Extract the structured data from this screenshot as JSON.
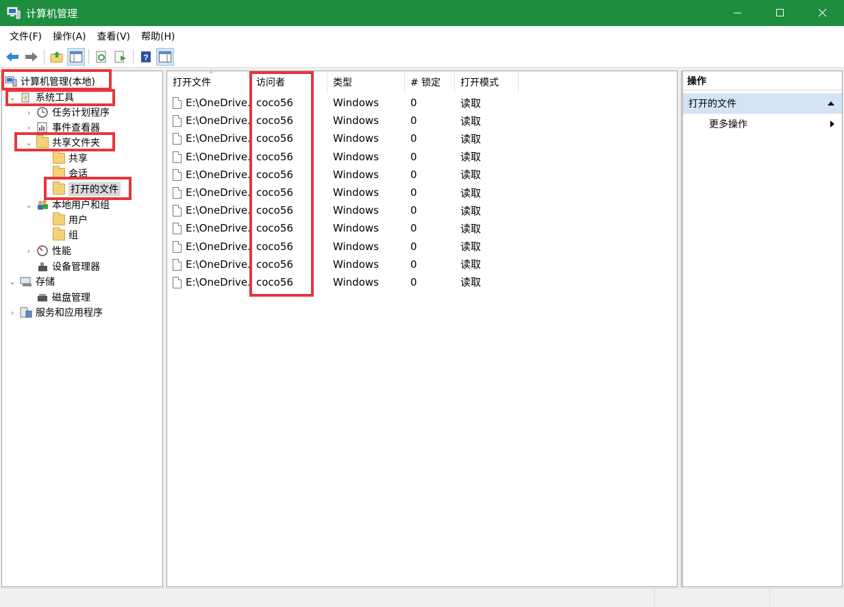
{
  "window": {
    "title": "计算机管理"
  },
  "menu": [
    "文件(F)",
    "操作(A)",
    "查看(V)",
    "帮助(H)"
  ],
  "toolbar": {
    "buttons": [
      "back-arrow-icon",
      "forward-arrow-icon",
      "up-folder-icon",
      "show-hide-tree-icon",
      "refresh-icon",
      "export-list-icon",
      "help-icon",
      "show-hide-action-pane-icon"
    ]
  },
  "tree": {
    "root": "计算机管理(本地)",
    "system_tools": "系统工具",
    "task_scheduler": "任务计划程序",
    "event_viewer": "事件查看器",
    "shared_folders": "共享文件夹",
    "shares": "共享",
    "sessions": "会话",
    "open_files": "打开的文件",
    "local_users": "本地用户和组",
    "users": "用户",
    "groups": "组",
    "performance": "性能",
    "device_manager": "设备管理器",
    "storage": "存储",
    "disk_management": "磁盘管理",
    "services_apps": "服务和应用程序"
  },
  "table": {
    "columns": [
      "打开文件",
      "访问者",
      "类型",
      "# 锁定",
      "打开模式"
    ],
    "rows": [
      [
        "E:\\OneDrive...",
        "coco56",
        "Windows",
        "0",
        "读取"
      ],
      [
        "E:\\OneDrive...",
        "coco56",
        "Windows",
        "0",
        "读取"
      ],
      [
        "E:\\OneDrive...",
        "coco56",
        "Windows",
        "0",
        "读取"
      ],
      [
        "E:\\OneDrive...",
        "coco56",
        "Windows",
        "0",
        "读取"
      ],
      [
        "E:\\OneDrive...",
        "coco56",
        "Windows",
        "0",
        "读取"
      ],
      [
        "E:\\OneDrive...",
        "coco56",
        "Windows",
        "0",
        "读取"
      ],
      [
        "E:\\OneDrive...",
        "coco56",
        "Windows",
        "0",
        "读取"
      ],
      [
        "E:\\OneDrive...",
        "coco56",
        "Windows",
        "0",
        "读取"
      ],
      [
        "E:\\OneDrive...",
        "coco56",
        "Windows",
        "0",
        "读取"
      ],
      [
        "E:\\OneDrive...",
        "coco56",
        "Windows",
        "0",
        "读取"
      ],
      [
        "E:\\OneDrive...",
        "coco56",
        "Windows",
        "0",
        "读取"
      ]
    ]
  },
  "actions": {
    "header": "操作",
    "section": "打开的文件",
    "more": "更多操作"
  },
  "colors": {
    "titlebar": "#1e8e3e",
    "highlight": "#e8353a",
    "action_section": "#d5e4f5"
  }
}
